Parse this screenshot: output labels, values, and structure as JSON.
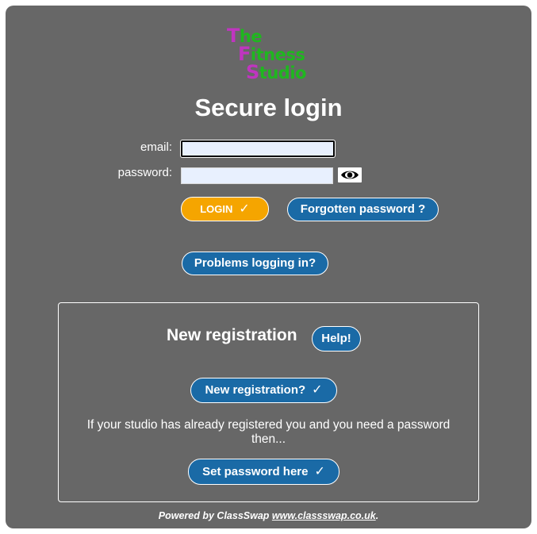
{
  "logo": {
    "line1_cap": "T",
    "line1_rest": "he",
    "line2_cap": "F",
    "line2_rest": "itness",
    "line3_cap": "S",
    "line3_rest": "tudio"
  },
  "title": "Secure login",
  "form": {
    "email_label": "email:",
    "email_value": "",
    "password_label": "password:",
    "password_value": ""
  },
  "buttons": {
    "login": "LOGIN",
    "forgot": "Forgotten password ?",
    "problems": "Problems logging in?"
  },
  "registration": {
    "title": "New registration",
    "help": "Help!",
    "new_registration": "New registration?",
    "info": "If your studio has already registered you and you need a password then...",
    "set_password": "Set password here"
  },
  "footer": {
    "prefix": "Powered by ClassSwap ",
    "link_text": "www.classswap.co.uk",
    "suffix": "."
  },
  "icons": {
    "check": "✓",
    "eye": "eye-icon"
  },
  "colors": {
    "panel": "#676767",
    "login_button": "#f5a500",
    "blue_button": "#1a6aa6",
    "logo_green": "#1fb71f",
    "logo_magenta": "#c035c0"
  }
}
